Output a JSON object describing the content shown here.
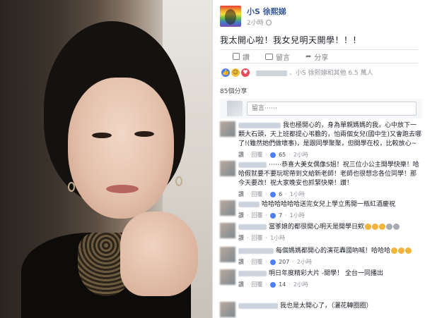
{
  "post": {
    "author": "小S 徐熙娣",
    "time": "2小時",
    "text": "我太開心啦！我女兒明天開學！！！",
    "actions": {
      "like": "讚",
      "comment": "留言",
      "share": "分享"
    },
    "reactions_text": "、小S 徐熙娣和其他 6.5 萬人",
    "share_count": "85個分享",
    "comment_placeholder": "留言⋯⋯"
  },
  "comments": [
    {
      "text": "我也極開心的，身為單親媽媽的我，心中放下一顆大石頭，天上班都提心弔膽的，怕兩個女兒(國中生)又會跑去哪了!(雖然她們做壞事)，是跟同學聚聚，但開學在校，比較放心~",
      "reply": "回覆",
      "likes": "65",
      "time": "2小時"
    },
    {
      "text": "⋯⋯恭喜大美女偶像S姐！祝三位小公主開學快樂！哈哈假就要不要玩呢帶到文給新老師！老師也很想念各位同學！那今天要改！祝大家晚安也抓緊快樂！讚！",
      "reply": "回覆",
      "likes": "6",
      "time": "1小時"
    },
    {
      "text": "哈哈哈哈哈哈送完女兒上學立馬開一瓶紅酒慶祝",
      "reply": "回覆",
      "likes": "7",
      "time": "1小時"
    },
    {
      "text": "當爹娘的都很開心明天是開學日欸",
      "reply": "回覆",
      "likes": "",
      "time": "1小時"
    },
    {
      "text": "每個媽媽都開心的演花轟國吶喊！哈哈哈",
      "reply": "回覆",
      "likes": "207",
      "time": "2小時"
    },
    {
      "text": "明日年度精彩大片 -開學！ 全台一同播出",
      "reply": "回覆",
      "likes": "14",
      "time": "2小時"
    },
    {
      "text": "我也是太開心了，（灑花轉圈圈）",
      "reply": "",
      "likes": "",
      "time": ""
    }
  ]
}
